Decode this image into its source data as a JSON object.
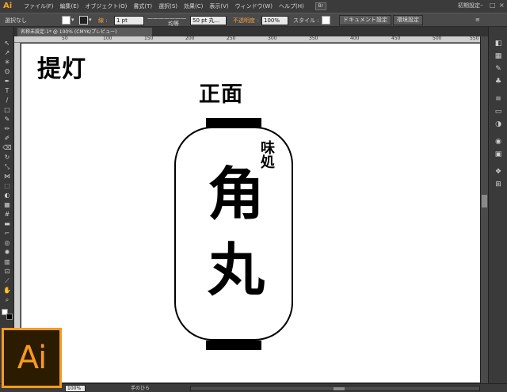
{
  "app": {
    "logo": "Ai",
    "workspace": "初期設定"
  },
  "menu": [
    "ファイル(F)",
    "編集(E)",
    "オブジェクト(O)",
    "書式(T)",
    "選択(S)",
    "効果(C)",
    "表示(V)",
    "ウィンドウ(W)",
    "ヘルプ(H)"
  ],
  "bridge_label": "Br",
  "control": {
    "selection_status": "選択なし",
    "stroke_label": "線 :",
    "stroke_weight": "1 pt",
    "stroke_style": "均等",
    "brush": "50 pt 丸...",
    "opacity_label": "不透明度 :",
    "opacity_value": "100%",
    "style_label": "スタイル :",
    "doc_settings": "ドキュメント設定",
    "env_settings": "環境設定"
  },
  "document": {
    "tab": "名称未設定-1* @ 100% (CMYK/プレビュー)"
  },
  "ruler": [
    "50",
    "100",
    "150",
    "200",
    "250",
    "300",
    "350",
    "400",
    "450",
    "500",
    "550"
  ],
  "artwork": {
    "title": "提灯",
    "subtitle": "正面",
    "small_text": "味処",
    "main_text": [
      "角",
      "丸"
    ]
  },
  "status": {
    "zoom": "100%",
    "tool": "手のひら"
  },
  "colors": {
    "accent": "#f79a1f",
    "canvas": "#ffffff",
    "ui_bg": "#3b3b3b"
  }
}
